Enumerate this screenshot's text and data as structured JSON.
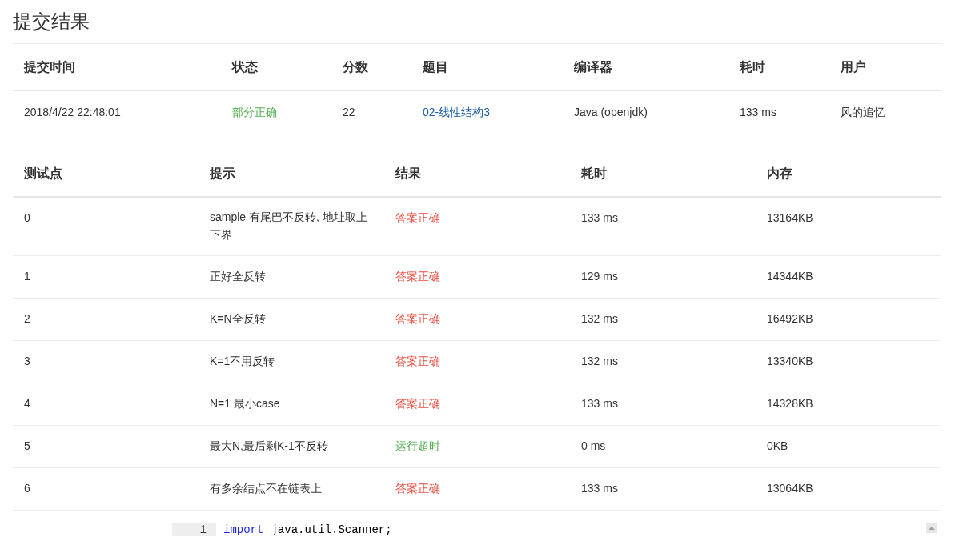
{
  "title": "提交结果",
  "submission": {
    "columns": [
      "提交时间",
      "状态",
      "分数",
      "题目",
      "编译器",
      "耗时",
      "用户"
    ],
    "row": {
      "time": "2018/4/22 22:48:01",
      "status": {
        "text": "部分正确",
        "color": "#4cae4c"
      },
      "score": "22",
      "problem": "02-线性结构3",
      "compiler": "Java (openjdk)",
      "duration": "133 ms",
      "user": "风的追忆"
    }
  },
  "tests": {
    "columns": [
      "测试点",
      "提示",
      "结果",
      "耗时",
      "内存"
    ],
    "rows": [
      {
        "id": "0",
        "hint": "sample 有尾巴不反转, 地址取上下界",
        "result": "答案正确",
        "color": "#e84c3d",
        "duration": "133 ms",
        "memory": "13164KB"
      },
      {
        "id": "1",
        "hint": "正好全反转",
        "result": "答案正确",
        "color": "#e84c3d",
        "duration": "129 ms",
        "memory": "14344KB"
      },
      {
        "id": "2",
        "hint": "K=N全反转",
        "result": "答案正确",
        "color": "#e84c3d",
        "duration": "132 ms",
        "memory": "16492KB"
      },
      {
        "id": "3",
        "hint": "K=1不用反转",
        "result": "答案正确",
        "color": "#e84c3d",
        "duration": "132 ms",
        "memory": "13340KB"
      },
      {
        "id": "4",
        "hint": "N=1 最小case",
        "result": "答案正确",
        "color": "#e84c3d",
        "duration": "133 ms",
        "memory": "14328KB"
      },
      {
        "id": "5",
        "hint": "最大N,最后剩K-1不反转",
        "result": "运行超时",
        "color": "#4cae4c",
        "duration": "0 ms",
        "memory": "0KB"
      },
      {
        "id": "6",
        "hint": "有多余结点不在链表上",
        "result": "答案正确",
        "color": "#e84c3d",
        "duration": "133 ms",
        "memory": "13064KB"
      }
    ]
  },
  "code_lines": [
    {
      "number": "1",
      "tokens": [
        {
          "kind": "keyword",
          "text": "import"
        },
        {
          "kind": "plain",
          "text": "java.util.Scanner;"
        }
      ]
    }
  ]
}
